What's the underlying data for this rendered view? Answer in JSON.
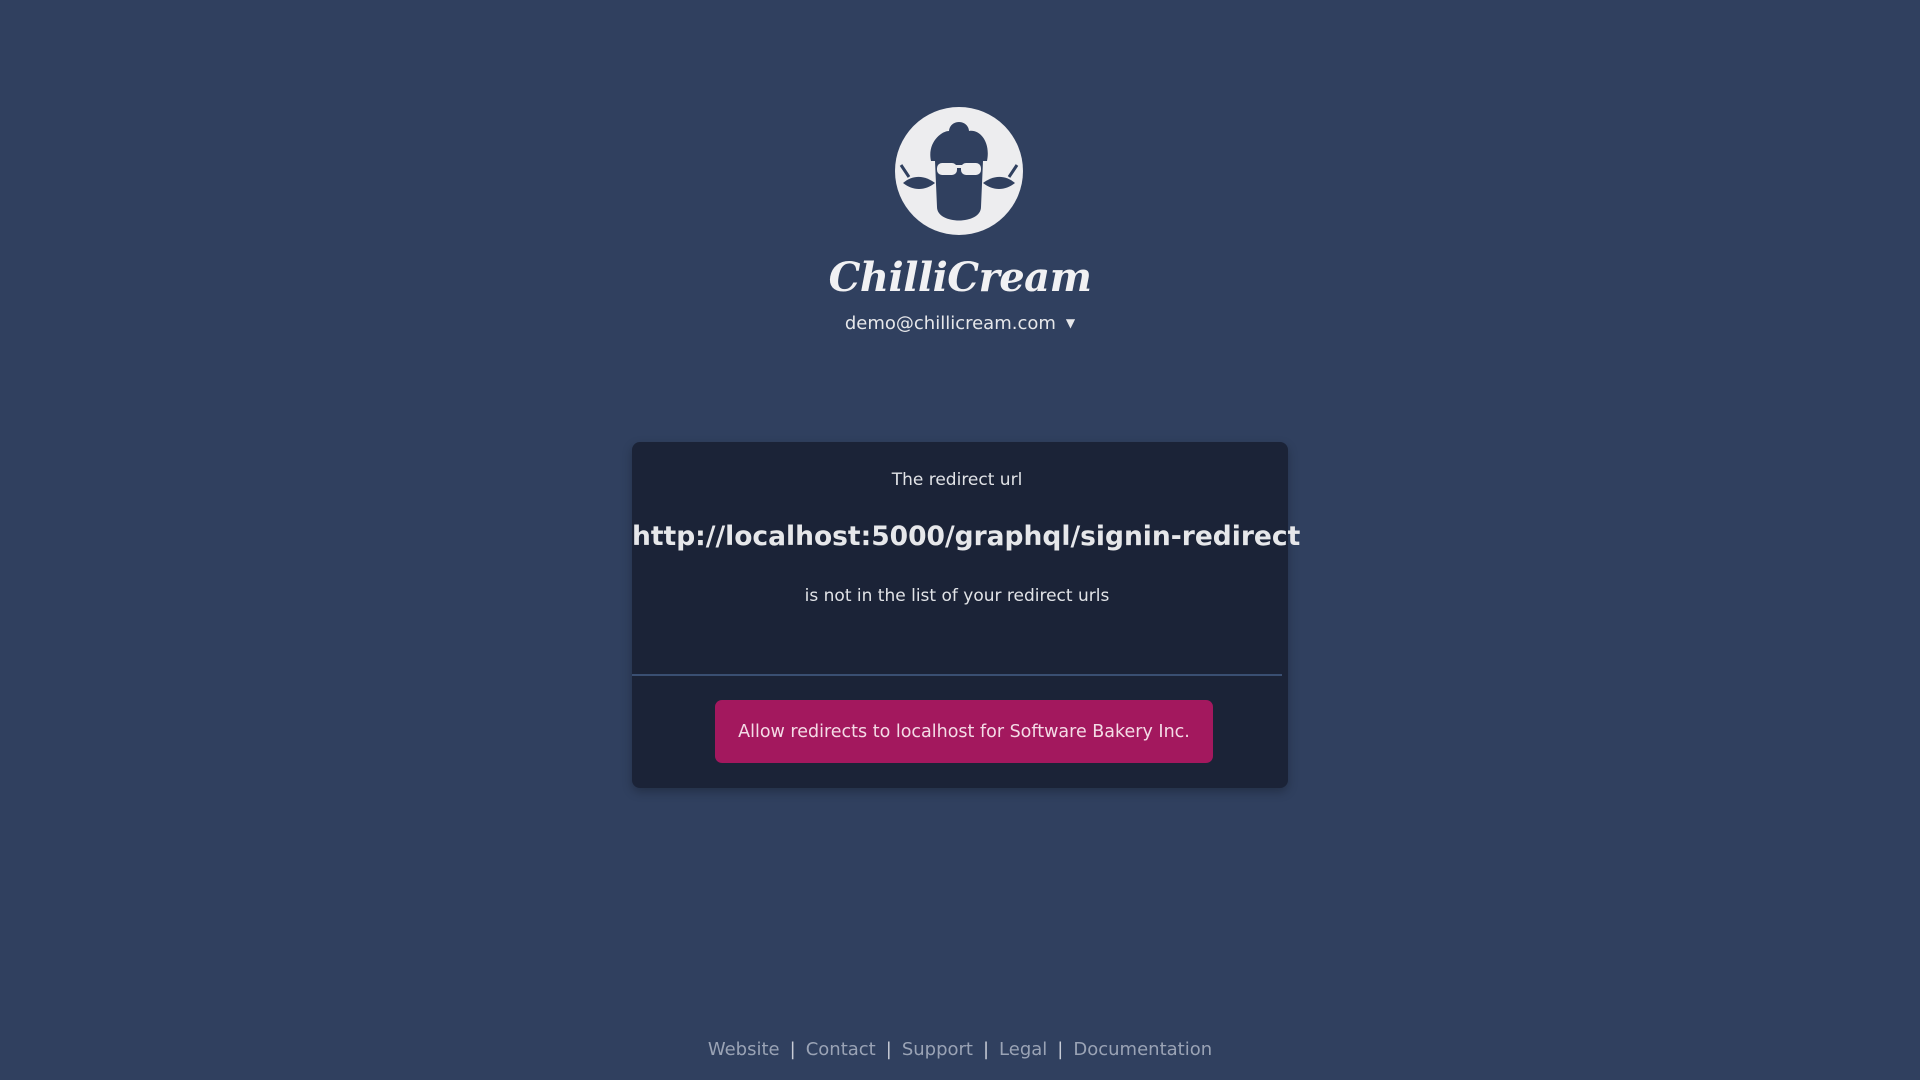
{
  "brand": {
    "name": "ChilliCream"
  },
  "account": {
    "email": "demo@chillicream.com",
    "caret_icon": "chevron-down-icon"
  },
  "card": {
    "intro": "The redirect url",
    "url": "http://localhost:5000/graphql/signin-redirect",
    "message": "is not in the list of your redirect urls",
    "allow_button_label": "Allow redirects to localhost for Software Bakery Inc."
  },
  "footer": {
    "links": [
      "Website",
      "Contact",
      "Support",
      "Legal",
      "Documentation"
    ],
    "separator": "|"
  },
  "colors": {
    "background": "#30405f",
    "card": "#1b2337",
    "accent": "#a3185e",
    "divider": "#3a4f72"
  }
}
